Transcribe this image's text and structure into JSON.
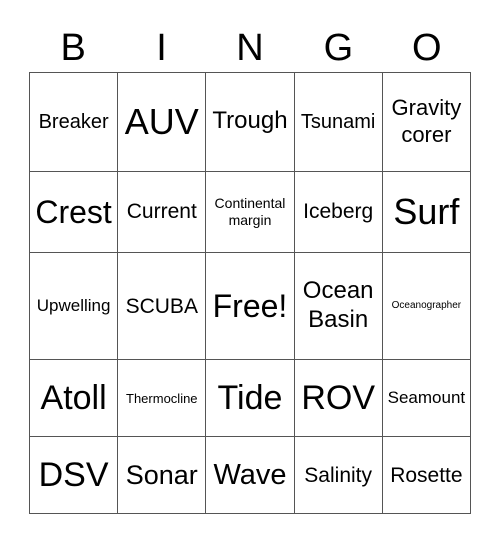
{
  "header": [
    "B",
    "I",
    "N",
    "G",
    "O"
  ],
  "cells": [
    [
      {
        "text": "Breaker",
        "size": 20
      },
      {
        "text": "AUV",
        "size": 36
      },
      {
        "text": "Trough",
        "size": 24
      },
      {
        "text": "Tsunami",
        "size": 20
      },
      {
        "text": "Gravity corer",
        "size": 22
      }
    ],
    [
      {
        "text": "Crest",
        "size": 32
      },
      {
        "text": "Current",
        "size": 21
      },
      {
        "text": "Continental margin",
        "size": 14
      },
      {
        "text": "Iceberg",
        "size": 21
      },
      {
        "text": "Surf",
        "size": 36
      }
    ],
    [
      {
        "text": "Upwelling",
        "size": 17
      },
      {
        "text": "SCUBA",
        "size": 21
      },
      {
        "text": "Free!",
        "size": 32
      },
      {
        "text": "Ocean Basin",
        "size": 24
      },
      {
        "text": "Oceanographer",
        "size": 10
      }
    ],
    [
      {
        "text": "Atoll",
        "size": 34
      },
      {
        "text": "Thermocline",
        "size": 13
      },
      {
        "text": "Tide",
        "size": 34
      },
      {
        "text": "ROV",
        "size": 34
      },
      {
        "text": "Seamount",
        "size": 17
      }
    ],
    [
      {
        "text": "DSV",
        "size": 34
      },
      {
        "text": "Sonar",
        "size": 27
      },
      {
        "text": "Wave",
        "size": 29
      },
      {
        "text": "Salinity",
        "size": 21
      },
      {
        "text": "Rosette",
        "size": 21
      }
    ]
  ]
}
